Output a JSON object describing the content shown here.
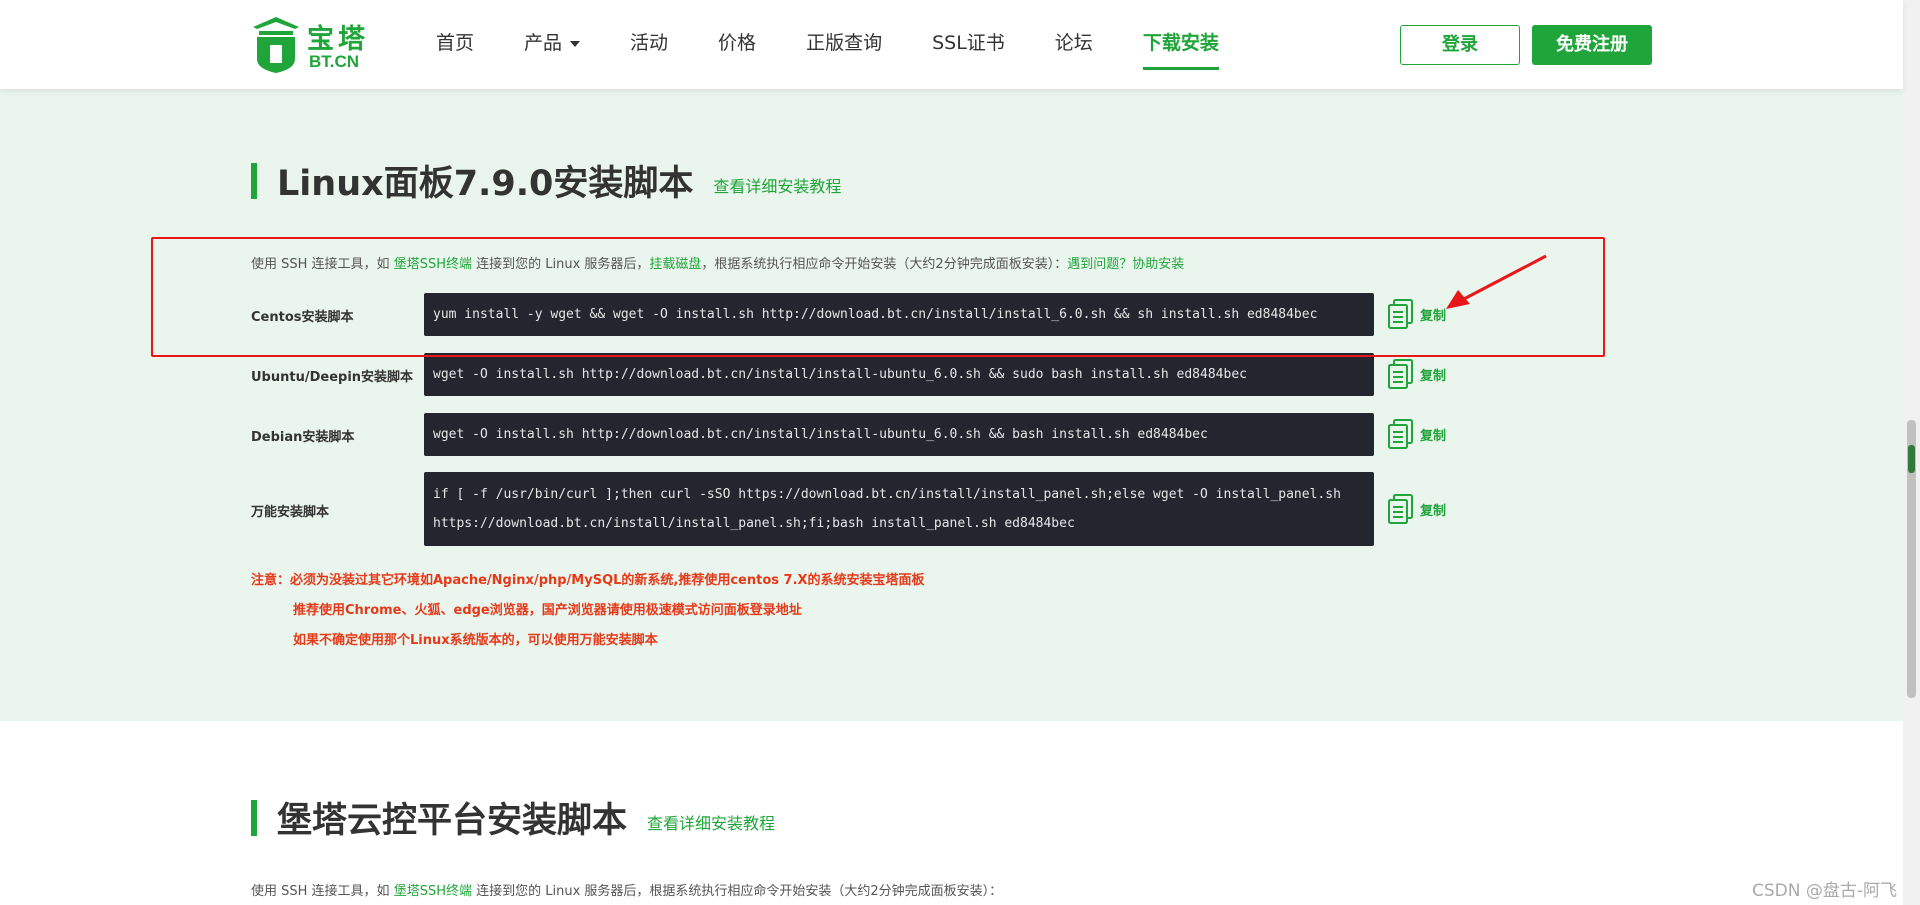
{
  "header": {
    "logo_cn": "宝塔",
    "logo_en": "BT.CN",
    "nav": [
      "首页",
      "产品",
      "活动",
      "价格",
      "正版查询",
      "SSL证书",
      "论坛",
      "下载安装"
    ],
    "login": "登录",
    "register": "免费注册"
  },
  "section1": {
    "title": "Linux面板7.9.0安装脚本",
    "tutorial_link": "查看详细安装教程",
    "desc": {
      "p1": "使用 SSH 连接工具，如 ",
      "link1": "堡塔SSH终端",
      "p2": " 连接到您的 Linux 服务器后，",
      "link2": "挂载磁盘",
      "p3": "，根据系统执行相应命令开始安装（大约2分钟完成面板安装）：",
      "link3": "遇到问题？协助安装"
    },
    "scripts": [
      {
        "label": "Centos安装脚本",
        "code": "yum install -y wget && wget -O install.sh http://download.bt.cn/install/install_6.0.sh && sh install.sh ed8484bec",
        "copy": "复制"
      },
      {
        "label": "Ubuntu/Deepin安装脚本",
        "code": "wget -O install.sh http://download.bt.cn/install/install-ubuntu_6.0.sh && sudo bash install.sh ed8484bec",
        "copy": "复制"
      },
      {
        "label": "Debian安装脚本",
        "code": "wget -O install.sh http://download.bt.cn/install/install-ubuntu_6.0.sh && bash install.sh ed8484bec",
        "copy": "复制"
      },
      {
        "label": "万能安装脚本",
        "code_line1": "if [ -f /usr/bin/curl ];then curl -sSO https://download.bt.cn/install/install_panel.sh;else wget -O install_panel.sh",
        "code_line2": "https://download.bt.cn/install/install_panel.sh;fi;bash install_panel.sh ed8484bec",
        "copy": "复制"
      }
    ],
    "notices": [
      "注意：必须为没装过其它环境如Apache/Nginx/php/MySQL的新系统,推荐使用centos 7.X的系统安装宝塔面板",
      "推荐使用Chrome、火狐、edge浏览器，国产浏览器请使用极速模式访问面板登录地址",
      "如果不确定使用那个Linux系统版本的，可以使用万能安装脚本"
    ]
  },
  "section2": {
    "title": "堡塔云控平台安装脚本",
    "tutorial_link": "查看详细安装教程",
    "desc_p1": "使用 SSH 连接工具，如 ",
    "desc_link": "堡塔SSH终端",
    "desc_p2": " 连接到您的 Linux 服务器后，根据系统执行相应命令开始安装（大约2分钟完成面板安装）："
  },
  "watermark": "CSDN @盘古-阿飞",
  "colors": {
    "brand": "#20a53a",
    "code_bg": "#23262f",
    "warning": "#e43a1a",
    "highlight": "#e81818"
  }
}
